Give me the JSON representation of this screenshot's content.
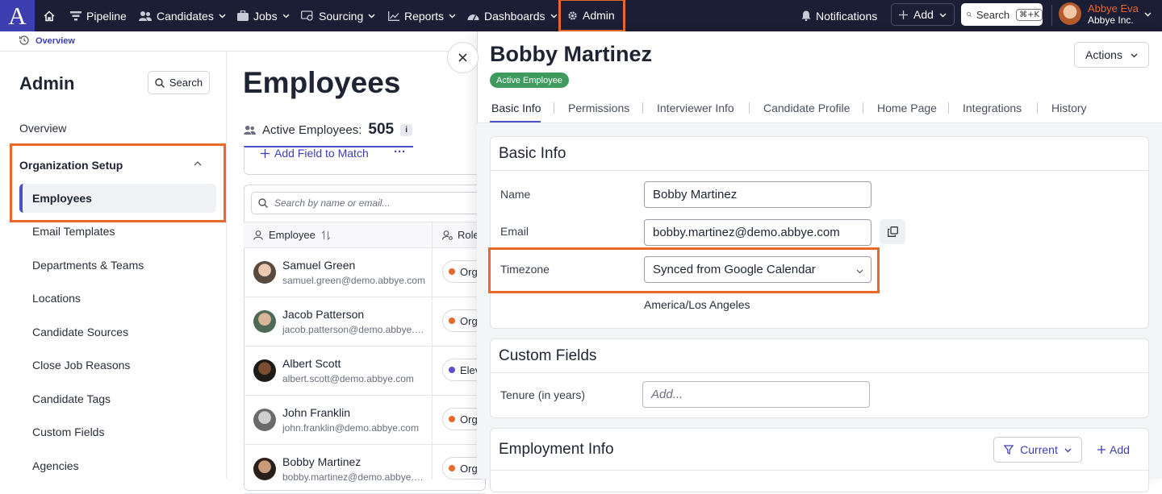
{
  "topnav": {
    "logo": "A",
    "items": [
      {
        "label": "Pipeline",
        "icon": "filter-icon"
      },
      {
        "label": "Candidates",
        "icon": "people-icon"
      },
      {
        "label": "Jobs",
        "icon": "briefcase-icon"
      },
      {
        "label": "Sourcing",
        "icon": "sourcing-icon"
      },
      {
        "label": "Reports",
        "icon": "chart-icon"
      },
      {
        "label": "Dashboards",
        "icon": "gauge-icon"
      },
      {
        "label": "Admin",
        "icon": "gear-icon"
      }
    ],
    "notifications": "Notifications",
    "add": "Add",
    "search": "Search",
    "shortcut": "⌘+K",
    "user_name": "Abbye Eva",
    "user_org": "Abbye Inc.",
    "highlight_color": "#e8692a"
  },
  "breadcrumb": {
    "label": "Overview"
  },
  "sidebar": {
    "title": "Admin",
    "search": "Search",
    "overview": "Overview",
    "group": "Organization Setup",
    "active": "Employees",
    "items": [
      "Email Templates",
      "Departments & Teams",
      "Locations",
      "Candidate Sources",
      "Close Job Reasons",
      "Candidate Tags",
      "Custom Fields",
      "Agencies"
    ]
  },
  "main": {
    "title": "Employees",
    "active_label": "Active Employees:",
    "active_count": "505",
    "info": "i",
    "add_field": "Add Field to Match",
    "more": "···",
    "search_placeholder": "Search by name or email...",
    "col_employee": "Employee",
    "col_role": "Role",
    "rows": [
      {
        "name": "Samuel Green",
        "email": "samuel.green@demo.abbye.com",
        "role": "Org",
        "dot": "#e8692a"
      },
      {
        "name": "Jacob Patterson",
        "email": "jacob.patterson@demo.abbye.com",
        "role": "Org",
        "dot": "#e8692a"
      },
      {
        "name": "Albert Scott",
        "email": "albert.scott@demo.abbye.com",
        "role": "Elev",
        "dot": "#5a4fd1"
      },
      {
        "name": "John Franklin",
        "email": "john.franklin@demo.abbye.com",
        "role": "Org",
        "dot": "#e8692a"
      },
      {
        "name": "Bobby Martinez",
        "email": "bobby.martinez@demo.abbye.com",
        "role": "Org",
        "dot": "#e8692a"
      }
    ]
  },
  "panel": {
    "name": "Bobby Martinez",
    "status": "Active Employee",
    "actions": "Actions",
    "tabs": [
      "Basic Info",
      "Permissions",
      "Interviewer Info",
      "Candidate Profile",
      "Home Page",
      "Integrations",
      "History"
    ],
    "basic": {
      "title": "Basic Info",
      "name_label": "Name",
      "name_value": "Bobby Martinez",
      "email_label": "Email",
      "email_value": "bobby.martinez@demo.abbye.com",
      "tz_label": "Timezone",
      "tz_value": "Synced from Google Calendar",
      "tz_note": "America/Los Angeles"
    },
    "custom": {
      "title": "Custom Fields",
      "tenure_label": "Tenure (in years)",
      "tenure_placeholder": "Add..."
    },
    "employment": {
      "title": "Employment Info",
      "filter": "Current",
      "add": "Add"
    }
  }
}
